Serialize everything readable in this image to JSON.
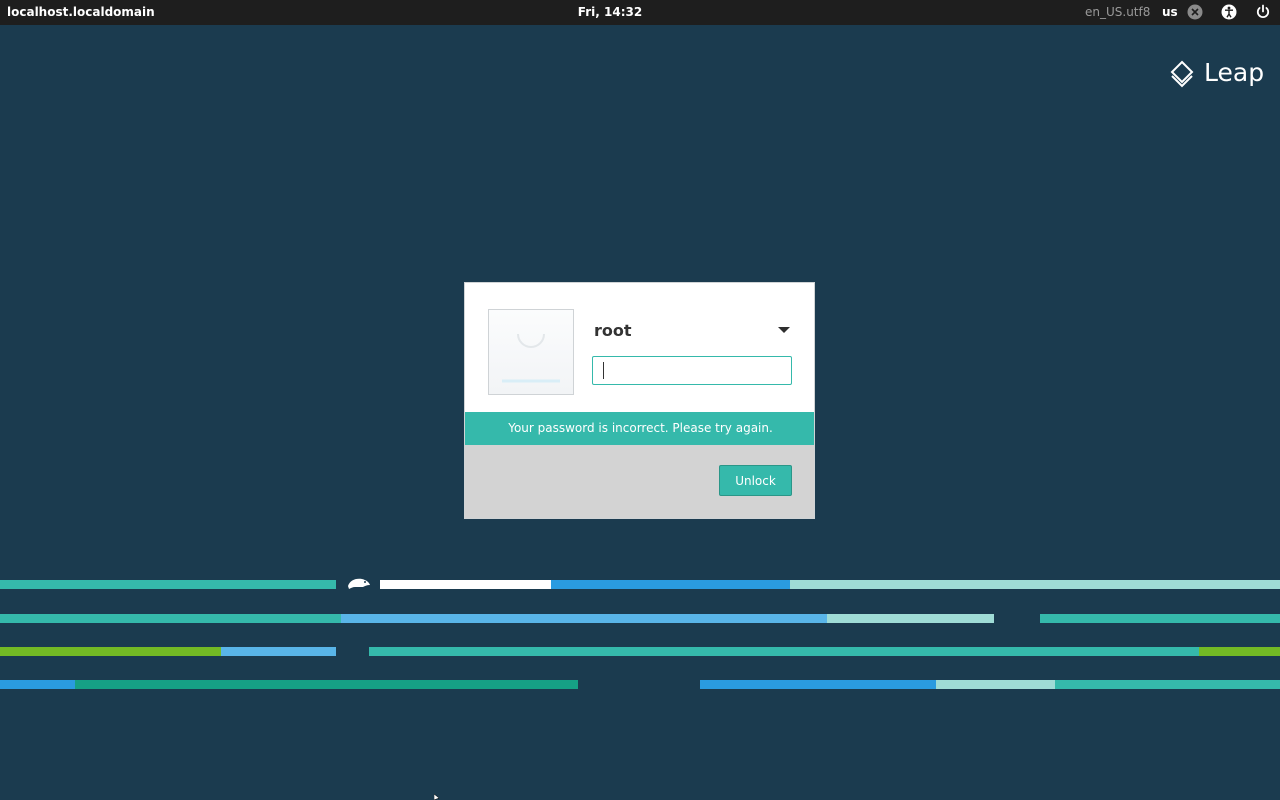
{
  "topbar": {
    "hostname": "localhost.localdomain",
    "clock": "Fri, 14:32",
    "locale": "en_US.utf8",
    "keyboard_layout": "us",
    "icons": [
      "xf-icon",
      "accessibility-icon",
      "power-icon"
    ]
  },
  "brand": {
    "text": "Leap"
  },
  "login": {
    "username": "root",
    "password_value": "",
    "error_message": "Your password is incorrect. Please try again.",
    "unlock_label": "Unlock"
  },
  "colors": {
    "background": "#1b3b4f",
    "topbar": "#1e1e1e",
    "accent": "#35b9ab",
    "footer": "#d3d3d3",
    "stripe_teal": "#35b9ab",
    "stripe_blue": "#2a9be0",
    "stripe_light_blue": "#59b5e8",
    "stripe_pale": "#9fdcd6",
    "stripe_green": "#73ba25",
    "stripe_dark_teal": "#16a085",
    "stripe_white": "#ffffff"
  }
}
